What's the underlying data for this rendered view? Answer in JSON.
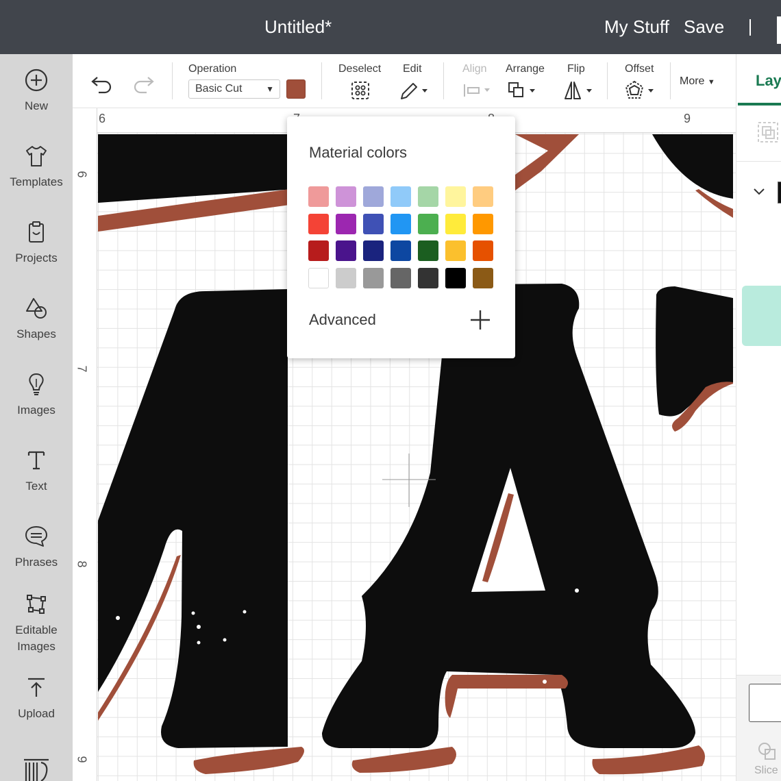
{
  "header": {
    "doc_title": "Untitled*",
    "my_stuff_label": "My Stuff",
    "save_label": "Save"
  },
  "sidebar": {
    "items": [
      {
        "label": "New",
        "icon": "plus-circle-icon"
      },
      {
        "label": "Templates",
        "icon": "tshirt-icon"
      },
      {
        "label": "Projects",
        "icon": "clipboard-icon"
      },
      {
        "label": "Shapes",
        "icon": "shapes-icon"
      },
      {
        "label": "Images",
        "icon": "lightbulb-icon"
      },
      {
        "label": "Text",
        "icon": "text-icon"
      },
      {
        "label": "Phrases",
        "icon": "chat-bubble-icon"
      },
      {
        "label": "Editable",
        "label2": "Images",
        "icon": "editable-images-icon"
      },
      {
        "label": "Upload",
        "icon": "upload-icon"
      }
    ]
  },
  "toolbar": {
    "operation_label": "Operation",
    "operation_value": "Basic Cut",
    "color_value": "#a04f3a",
    "deselect_label": "Deselect",
    "edit_label": "Edit",
    "align_label": "Align",
    "arrange_label": "Arrange",
    "flip_label": "Flip",
    "offset_label": "Offset",
    "more_label": "More"
  },
  "right_panel": {
    "layers_tab_label": "Laye",
    "slice_label": "Slice"
  },
  "rulers": {
    "top": [
      "6",
      "7",
      "8",
      "9"
    ],
    "left": [
      "6",
      "7",
      "8",
      "9"
    ]
  },
  "color_popup": {
    "title": "Material colors",
    "advanced_label": "Advanced",
    "swatches": [
      [
        "#ef9a9a",
        "#ce93d8",
        "#9fa8da",
        "#90caf9",
        "#a5d6a7",
        "#fff59d",
        "#ffcc80"
      ],
      [
        "#f44336",
        "#9c27b0",
        "#3f51b5",
        "#2196f3",
        "#4caf50",
        "#ffeb3b",
        "#ff9800"
      ],
      [
        "#b71c1c",
        "#4a148c",
        "#1a237e",
        "#0d47a1",
        "#1b5e20",
        "#fbc02d",
        "#e65100"
      ],
      [
        "#ffffff",
        "#cccccc",
        "#999999",
        "#666666",
        "#333333",
        "#000000",
        "#8b5a16"
      ]
    ]
  },
  "colors": {
    "topbar": "#41454c",
    "sidebar": "#d6d6d6",
    "accent": "#1a7a52",
    "design_black": "#0d0d0d",
    "design_brown": "#a04f3a"
  }
}
